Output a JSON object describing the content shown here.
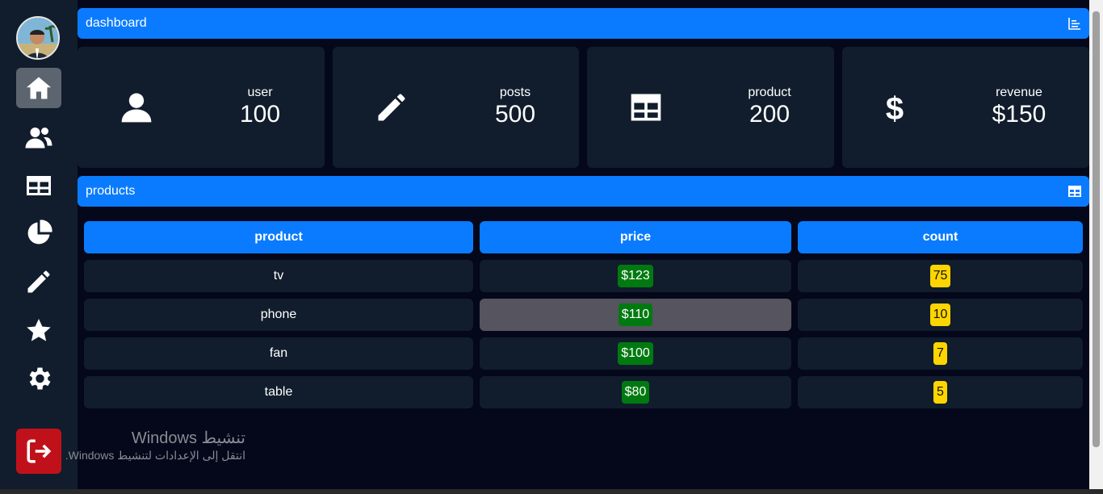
{
  "sidebar": {
    "avatar_alt": "user avatar",
    "items": [
      {
        "icon": "home-icon",
        "active": true
      },
      {
        "icon": "users-icon",
        "active": false
      },
      {
        "icon": "table-icon",
        "active": false
      },
      {
        "icon": "pie-chart-icon",
        "active": false
      },
      {
        "icon": "pencil-icon",
        "active": false
      },
      {
        "icon": "star-icon",
        "active": false
      },
      {
        "icon": "gear-icon",
        "active": false
      }
    ],
    "logout_icon": "logout-icon"
  },
  "dashboard_bar": {
    "title": "dashboard",
    "icon": "chart-icon"
  },
  "stats": [
    {
      "label": "user",
      "value": "100",
      "icon": "user-icon"
    },
    {
      "label": "posts",
      "value": "500",
      "icon": "pencil-icon"
    },
    {
      "label": "product",
      "value": "200",
      "icon": "table-icon"
    },
    {
      "label": "revenue",
      "value": "$150",
      "icon": "dollar-icon"
    }
  ],
  "products_bar": {
    "title": "products",
    "icon": "table-icon"
  },
  "table": {
    "headers": [
      "product",
      "price",
      "count"
    ],
    "rows": [
      {
        "product": "tv",
        "price": "$123",
        "count": "75"
      },
      {
        "product": "phone",
        "price": "$110",
        "count": "10"
      },
      {
        "product": "fan",
        "price": "$100",
        "count": "7"
      },
      {
        "product": "table",
        "price": "$80",
        "count": "5"
      }
    ]
  },
  "watermark": {
    "title": "تنشيط Windows",
    "subtitle": "انتقل إلى الإعدادات لتنشيط Windows."
  },
  "colors": {
    "accent": "#0a7bff",
    "panel": "#111d2c",
    "background": "#04081a",
    "price_badge": "#007a10",
    "count_badge": "#ffd500",
    "logout": "#c0111b"
  }
}
